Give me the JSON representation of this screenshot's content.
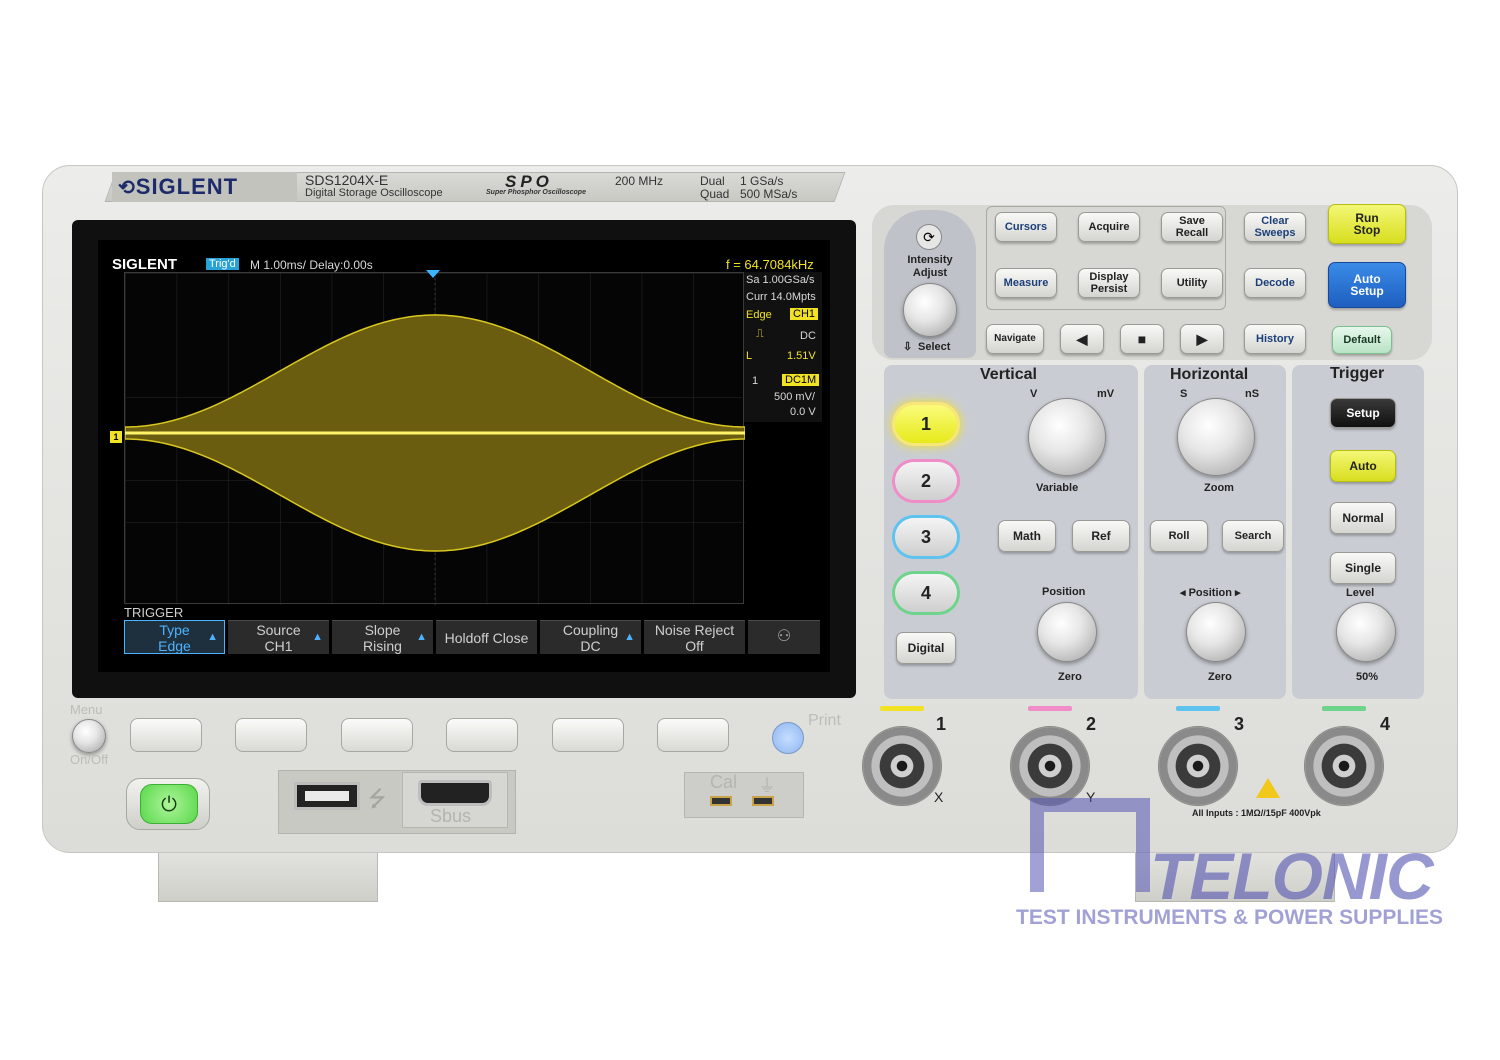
{
  "header": {
    "brand": "SIGLENT",
    "model": "SDS1204X-E",
    "model_sub": "Digital Storage Oscilloscope",
    "spo": "SPO",
    "spo_sub": "Super Phosphor Oscilloscope",
    "bandwidth": "200  MHz",
    "dual_label": "Dual",
    "dual_rate": "1 GSa/s",
    "quad_label": "Quad",
    "quad_rate": "500 MSa/s"
  },
  "screen": {
    "logo": "SIGLENT",
    "trig_status": "Trig'd",
    "timebase": "M 1.00ms/ Delay:0.00s",
    "frequency": "f = 64.7084kHz",
    "sample_rate": "Sa 1.00GSa/s",
    "memory": "Curr 14.0Mpts",
    "trig_type": "Edge",
    "trig_source": "CH1",
    "trig_coupling": "DC",
    "trig_level_label": "L",
    "trig_level": "1.51V",
    "ch_num": "1",
    "ch_coupling": "DC1M",
    "ch_scale": "500 mV/",
    "ch_offset": "0.0 V",
    "menu_title": "TRIGGER",
    "softkeys": [
      {
        "top": "Type",
        "bottom": "Edge"
      },
      {
        "top": "Source",
        "bottom": "CH1"
      },
      {
        "top": "Slope",
        "bottom": "Rising"
      },
      {
        "top": "Holdoff Close",
        "bottom": ""
      },
      {
        "top": "Coupling",
        "bottom": "DC"
      },
      {
        "top": "Noise Reject",
        "bottom": "Off"
      }
    ]
  },
  "menu_key": "Menu",
  "onoff_key": "On/Off",
  "print_key": "Print",
  "ports": {
    "sbus": "Sbus",
    "cal": "Cal"
  },
  "top_buttons": {
    "cursors": "Cursors",
    "acquire": "Acquire",
    "save_recall": [
      "Save",
      "Recall"
    ],
    "clear_sweeps": [
      "Clear",
      "Sweeps"
    ],
    "run_stop": [
      "Run",
      "Stop"
    ],
    "measure": "Measure",
    "display_persist": [
      "Display",
      "Persist"
    ],
    "utility": "Utility",
    "decode": "Decode",
    "auto_setup": [
      "Auto",
      "Setup"
    ],
    "navigate": "Navigate",
    "history": "History",
    "default": "Default"
  },
  "intensity": {
    "label": [
      "Intensity",
      "Adjust"
    ],
    "select": "Select"
  },
  "vertical": {
    "title": "Vertical",
    "v": "V",
    "mv": "mV",
    "variable": "Variable",
    "channels": [
      "1",
      "2",
      "3",
      "4"
    ],
    "math": "Math",
    "ref": "Ref",
    "digital": "Digital",
    "position": "Position",
    "zero": "Zero"
  },
  "horizontal": {
    "title": "Horizontal",
    "s": "S",
    "ns": "nS",
    "zoom": "Zoom",
    "roll": "Roll",
    "search": "Search",
    "position": "◂ Position ▸",
    "zero": "Zero"
  },
  "trigger": {
    "title": "Trigger",
    "setup": "Setup",
    "auto": "Auto",
    "normal": "Normal",
    "single": "Single",
    "level": "Level",
    "fifty": "50%"
  },
  "inputs": {
    "labels": [
      "1",
      "2",
      "3",
      "4"
    ],
    "x": "X",
    "y": "Y",
    "rating": "All Inputs : 1MΩ//15pF  400Vpk"
  },
  "colors": {
    "ch1": "#f2e224",
    "ch2": "#f08cc8",
    "ch3": "#5fc3ef",
    "ch4": "#6ed48c"
  },
  "watermark": {
    "name": "TELONIC",
    "tagline": "TEST INSTRUMENTS & POWER SUPPLIES"
  }
}
